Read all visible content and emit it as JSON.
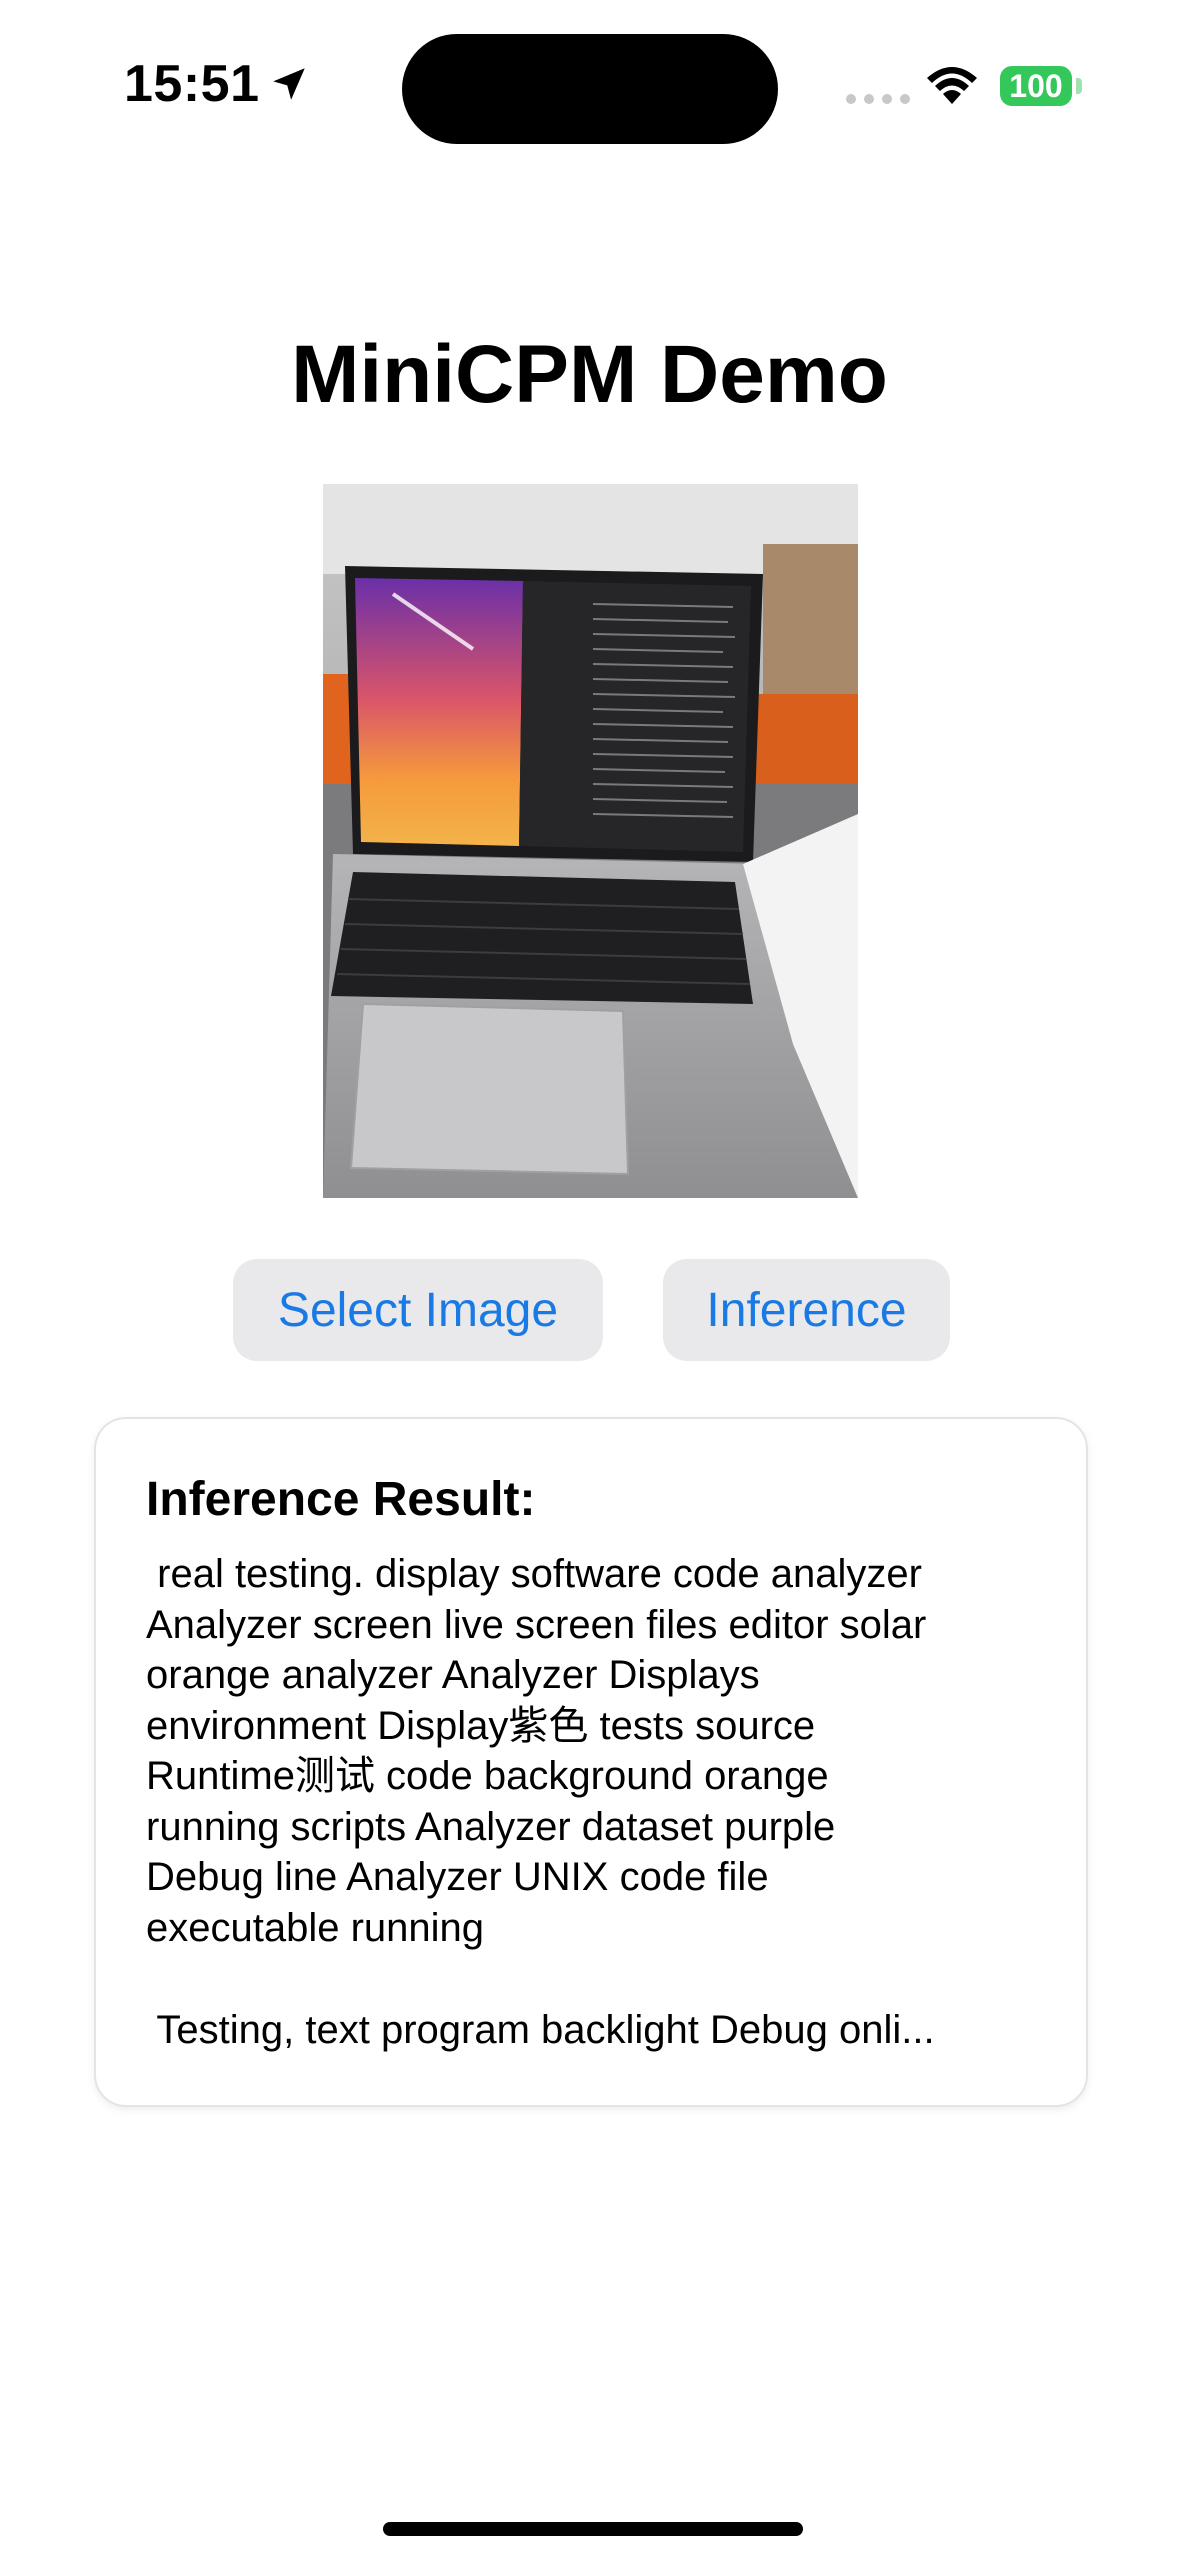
{
  "status_bar": {
    "time": "15:51",
    "battery": "100",
    "icons": [
      "location-arrow-icon",
      "cellular-signal-icon",
      "wifi-icon",
      "battery-icon"
    ]
  },
  "header": {
    "title": "MiniCPM Demo"
  },
  "actions": {
    "select_image_label": "Select Image",
    "inference_label": "Inference"
  },
  "result": {
    "heading": "Inference Result:",
    "body": " real testing. display software code analyzer\nAnalyzer screen live screen files editor solar\norange analyzer Analyzer Displays\nenvironment Display紫色 tests source\nRuntime测试 code background orange\nrunning scripts Analyzer dataset purple\nDebug line Analyzer UNIX code file\nexecutable running",
    "tail": " Testing, text program backlight Debug onli..."
  },
  "colors": {
    "accent": "#1a7ae5",
    "button_background": "#e9e9eb",
    "battery_green": "#34c759"
  }
}
